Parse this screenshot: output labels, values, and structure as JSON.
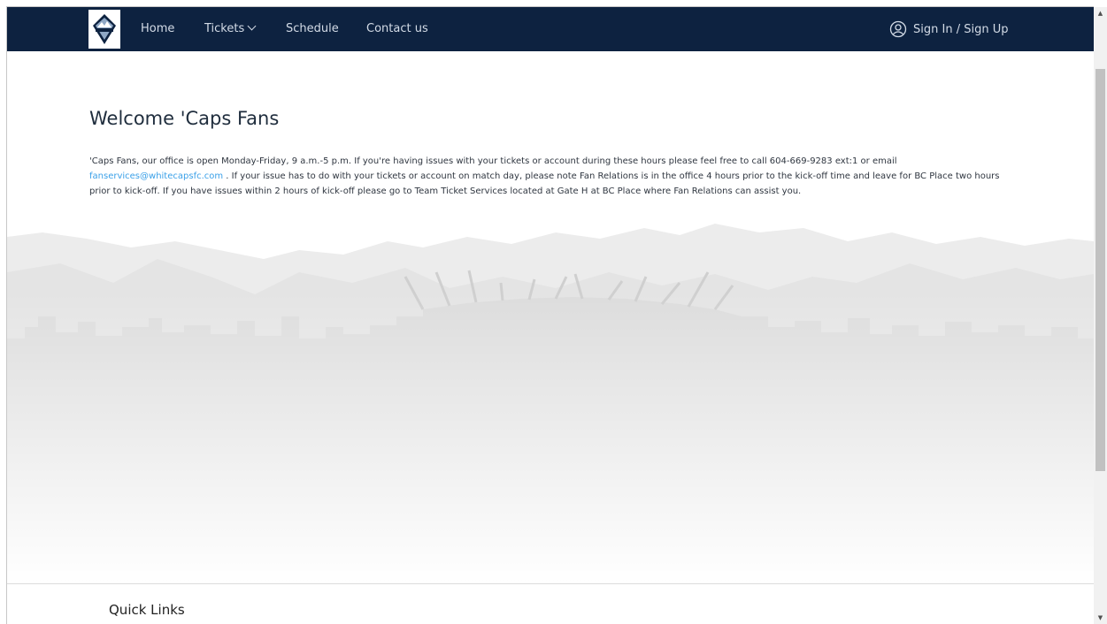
{
  "nav": {
    "logo_alt": "Vancouver Whitecaps FC",
    "items": [
      {
        "label": "Home"
      },
      {
        "label": "Tickets"
      },
      {
        "label": "Schedule"
      },
      {
        "label": "Contact us"
      }
    ],
    "signin_label": "Sign In / Sign Up"
  },
  "main": {
    "title": "Welcome 'Caps Fans",
    "intro": {
      "part1": "'Caps Fans, our office is open Monday-Friday, 9 a.m.-5 p.m. If you're having issues with your tickets or account during these hours please feel free to call 604-669-9283 ext:1 or email ",
      "email": "fanservices@whitecapsfc.com",
      "part2": " . If your issue has to do with your tickets or account on match day, please note Fan Relations is in the office 4 hours prior to the kick-off time and leave for BC Place two hours prior to kick-off. If you have issues within 2 hours of kick-off please go to Team Ticket Services located at Gate H at BC Place where Fan Relations can assist you."
    },
    "quick_links_heading": "Quick Links"
  },
  "colors": {
    "nav_bg": "#0d2240",
    "nav_text": "#d3dbe6",
    "link": "#3aa0e8",
    "title": "#1f2d3d"
  },
  "icons": {
    "logo": "whitecaps-crest-icon",
    "tickets_dropdown": "chevron-down-icon",
    "signin": "user-circle-icon",
    "scroll_up": "arrow-up-icon",
    "scroll_down": "arrow-down-icon"
  }
}
